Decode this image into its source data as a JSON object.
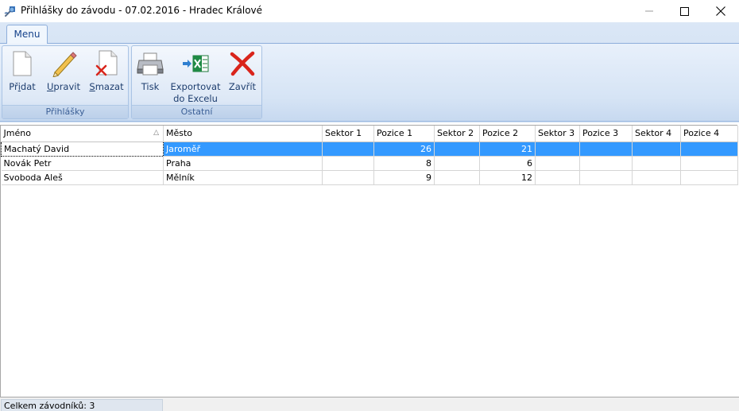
{
  "window": {
    "title": "Přihlášky do závodu - 07.02.2016 - Hradec Králové"
  },
  "ribbon": {
    "tab_label": "Menu",
    "groups": [
      {
        "label": "Přihlášky",
        "buttons": [
          {
            "label_pre": "Př",
            "label_accel": "i",
            "label_post": "dat",
            "icon": "document-icon"
          },
          {
            "label_pre": "",
            "label_accel": "U",
            "label_post": "pravit",
            "icon": "pencil-icon"
          },
          {
            "label_pre": "",
            "label_accel": "S",
            "label_post": "mazat",
            "icon": "delete-document-icon"
          }
        ]
      },
      {
        "label": "Ostatní",
        "buttons": [
          {
            "label": "Tisk",
            "icon": "printer-icon"
          },
          {
            "label_line1": "Exportovat",
            "label_line2": "do Excelu",
            "icon": "excel-export-icon"
          },
          {
            "label": "Zavřít",
            "icon": "close-x-icon"
          }
        ]
      }
    ]
  },
  "grid": {
    "columns": [
      "Jméno",
      "Město",
      "Sektor 1",
      "Pozice 1",
      "Sektor 2",
      "Pozice 2",
      "Sektor 3",
      "Pozice 3",
      "Sektor 4",
      "Pozice 4"
    ],
    "sort_indicator": "△",
    "rows": [
      {
        "cells": [
          "Machatý David",
          "Jaroměř",
          "",
          "26",
          "",
          "21",
          "",
          "",
          "",
          ""
        ],
        "selected": true
      },
      {
        "cells": [
          "Novák Petr",
          "Praha",
          "",
          "8",
          "",
          "6",
          "",
          "",
          "",
          ""
        ],
        "selected": false
      },
      {
        "cells": [
          "Svoboda Aleš",
          "Mělník",
          "",
          "9",
          "",
          "12",
          "",
          "",
          "",
          ""
        ],
        "selected": false
      }
    ]
  },
  "status": {
    "text": "Celkem závodníků: 3"
  },
  "colors": {
    "selection": "#3399ff",
    "ribbon_text": "#1e3e6e",
    "close_red": "#d9251c"
  }
}
